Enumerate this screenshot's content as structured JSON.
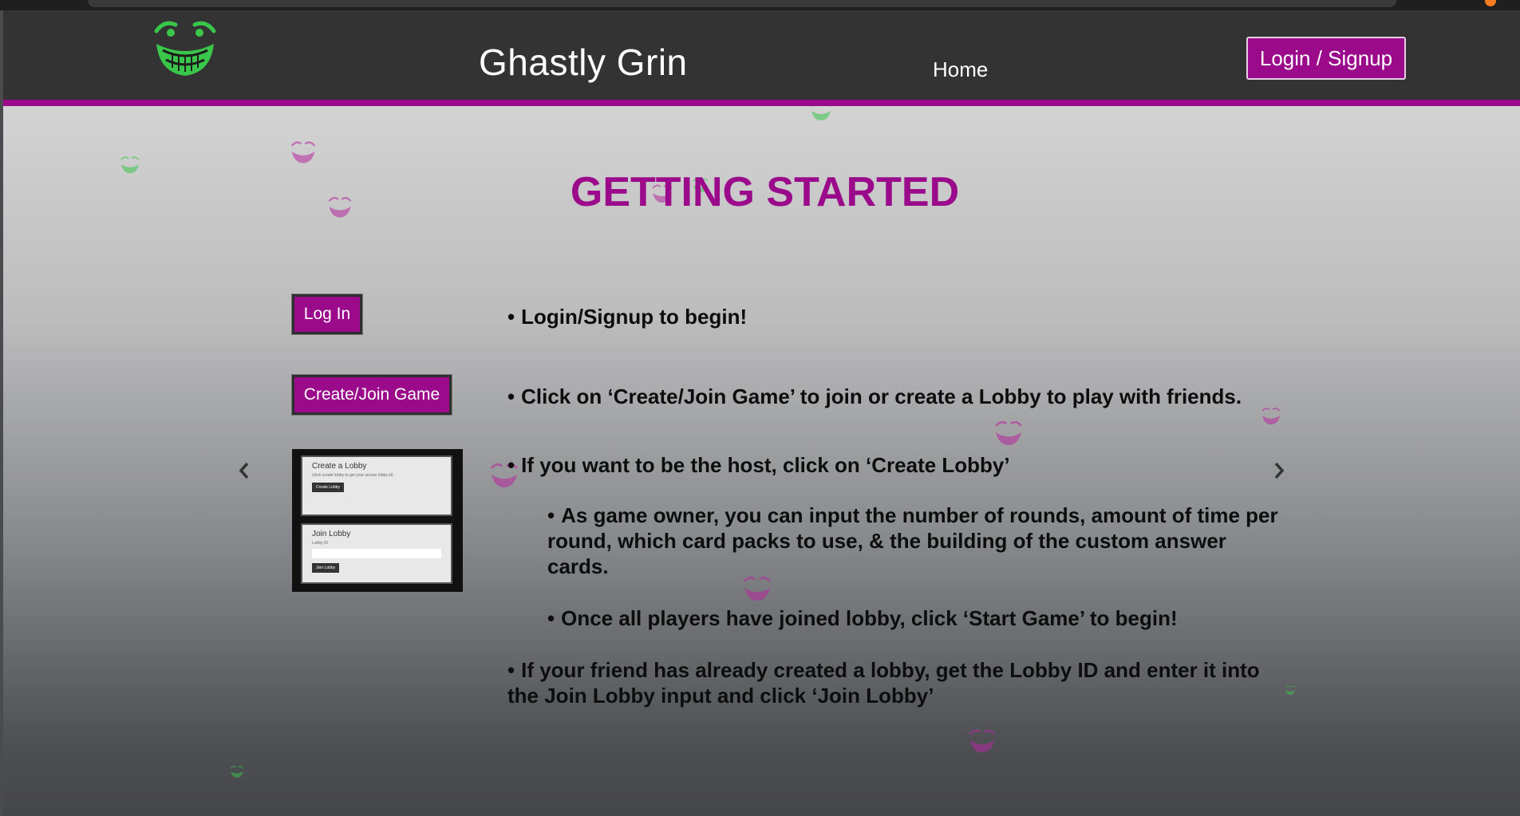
{
  "header": {
    "logo_icon": "grinning-face-logo-icon",
    "brand": "Ghastly Grin",
    "nav_home": "Home",
    "login_signup": "Login / Signup"
  },
  "main": {
    "title": "GETTING STARTED",
    "demo_login_label": "Log In",
    "demo_create_label": "Create/Join Game",
    "preview": {
      "create_title": "Create a Lobby",
      "create_sub": "(click create lobby to get your secure lobby id)",
      "create_btn": "Create Lobby",
      "join_title": "Join Lobby",
      "join_sub": "Lobby ID",
      "join_btn": "Join Lobby"
    },
    "steps": {
      "s1": "Login/Signup to begin!",
      "s2": "Click on ‘Create/Join Game’ to join or create a Lobby to play with friends.",
      "s3": "If you want to be the host, click on ‘Create Lobby’",
      "s4": "As game owner, you can input the number of rounds, amount of time per round, which card packs to use, & the building of the custom answer cards.",
      "s5": "Once all players have joined lobby, click ‘Start Game’ to begin!",
      "s6": "If your friend has already created a lobby, get the Lobby ID and enter it into the Join Lobby input and click ‘Join Lobby’"
    },
    "bullet": "•",
    "prev_icon": "chevron-left-icon",
    "next_icon": "chevron-right-icon"
  },
  "colors": {
    "brand_purple": "#9a0a8a",
    "navbar": "#333333",
    "logo_green": "#3ac64a"
  }
}
